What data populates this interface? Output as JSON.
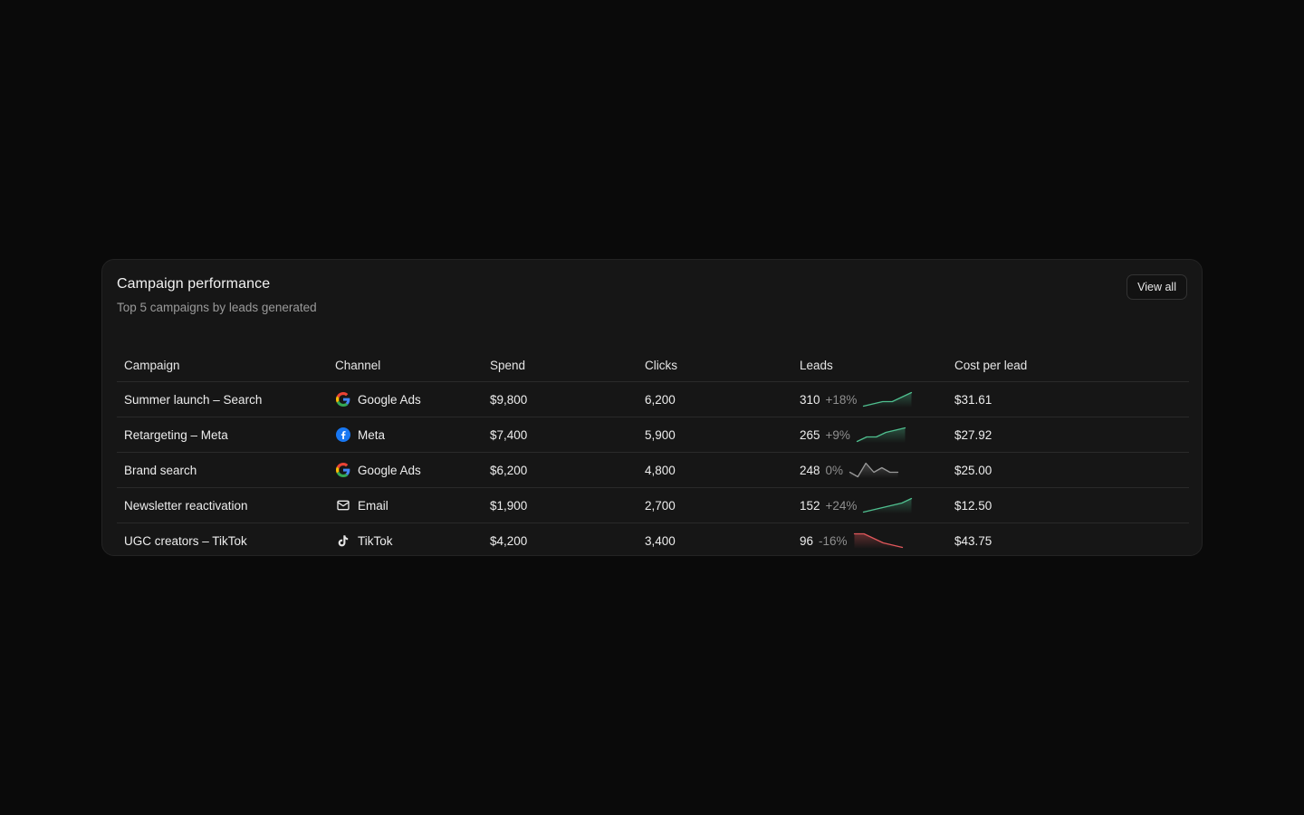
{
  "card": {
    "title": "Campaign performance",
    "subtitle": "Top 5 campaigns by leads generated",
    "view_all_label": "View all"
  },
  "table": {
    "headers": {
      "campaign": "Campaign",
      "channel": "Channel",
      "spend": "Spend",
      "clicks": "Clicks",
      "leads": "Leads",
      "cpl": "Cost per lead"
    },
    "rows": [
      {
        "campaign": "Summer launch – Search",
        "channel": "Google Ads",
        "channel_icon": "google-icon",
        "spend": "$9,800",
        "clicks": "6,200",
        "leads": "310",
        "change": "+18%",
        "trend": "up",
        "spark": [
          2,
          3,
          4,
          4,
          6,
          8
        ],
        "cpl": "$31.61"
      },
      {
        "campaign": "Retargeting – Meta",
        "channel": "Meta",
        "channel_icon": "facebook-icon",
        "spend": "$7,400",
        "clicks": "5,900",
        "leads": "265",
        "change": "+9%",
        "trend": "up",
        "spark": [
          2,
          4,
          4,
          6,
          7,
          8
        ],
        "cpl": "$27.92"
      },
      {
        "campaign": "Brand search",
        "channel": "Google Ads",
        "channel_icon": "google-icon",
        "spend": "$6,200",
        "clicks": "4,800",
        "leads": "248",
        "change": "0%",
        "trend": "flat",
        "spark": [
          4,
          2,
          8,
          4,
          6,
          4,
          4
        ],
        "cpl": "$25.00"
      },
      {
        "campaign": "Newsletter reactivation",
        "channel": "Email",
        "channel_icon": "mail-icon",
        "spend": "$1,900",
        "clicks": "2,700",
        "leads": "152",
        "change": "+24%",
        "trend": "up",
        "spark": [
          2,
          3,
          4,
          5,
          6,
          8
        ],
        "cpl": "$12.50"
      },
      {
        "campaign": "UGC creators – TikTok",
        "channel": "TikTok",
        "channel_icon": "tiktok-icon",
        "spend": "$4,200",
        "clicks": "3,400",
        "leads": "96",
        "change": "-16%",
        "trend": "down",
        "spark": [
          8,
          8,
          6,
          4,
          3,
          2
        ],
        "cpl": "$43.75"
      }
    ]
  },
  "colors": {
    "up": "#4fbf8f",
    "down": "#e0575b",
    "flat": "#9a9a9a"
  }
}
